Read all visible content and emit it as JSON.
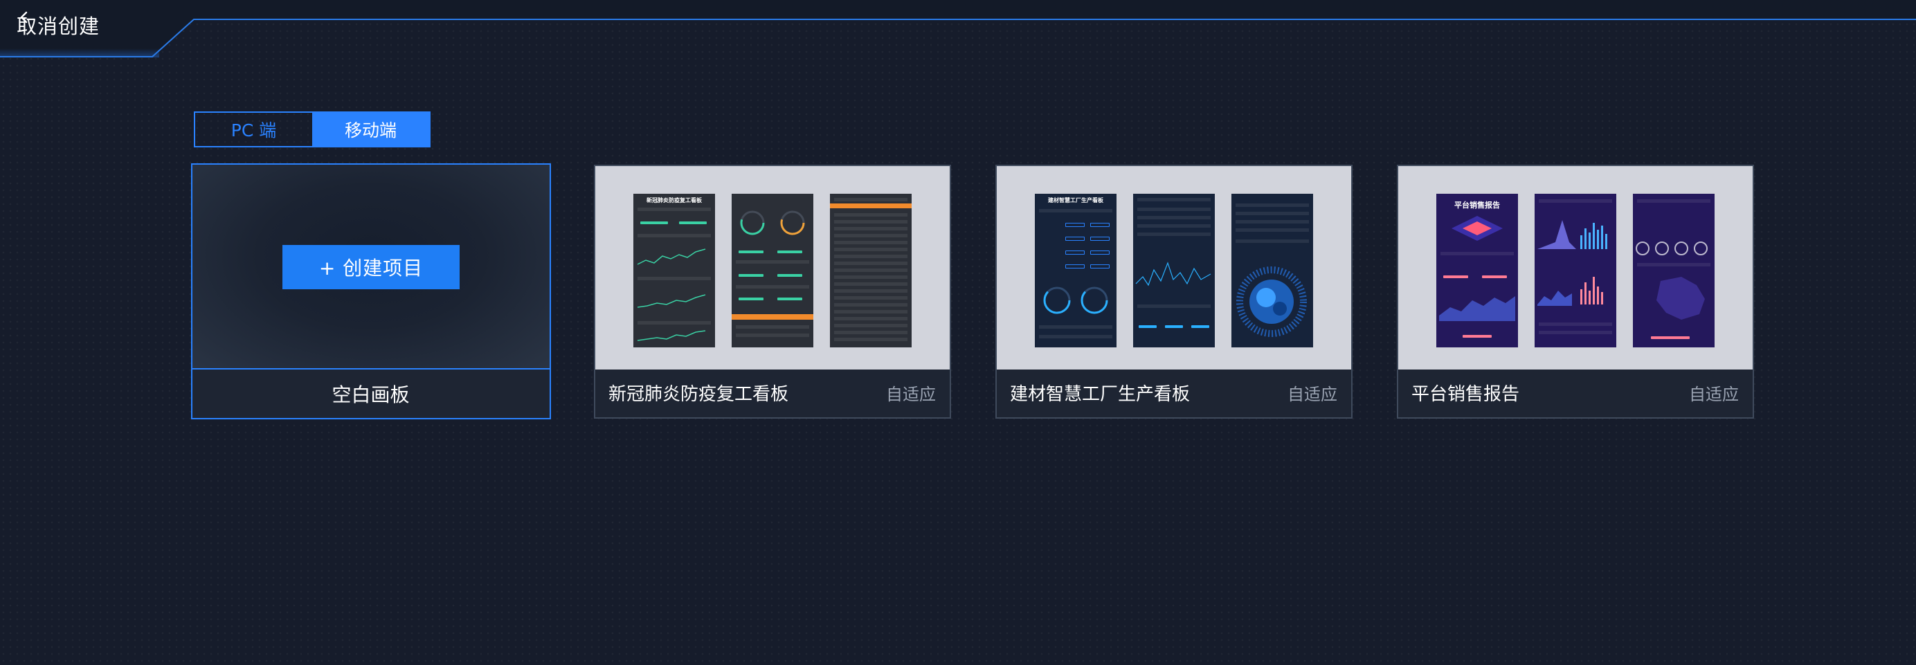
{
  "header": {
    "back_label": "取消创建",
    "back_icon": "chevron-left-icon"
  },
  "platform_switch": {
    "options": [
      "PC 端",
      "移动端"
    ],
    "selected": "移动端"
  },
  "cards": {
    "blank": {
      "name": "空白画板",
      "create_label": "+ 创建项目"
    },
    "templates": [
      {
        "name": "新冠肺炎防疫复工看板",
        "tag": "自适应",
        "preview_title": "新冠肺炎防疫复工看板"
      },
      {
        "name": "建材智慧工厂生产看板",
        "tag": "自适应",
        "preview_title": "建材智慧工厂生产看板"
      },
      {
        "name": "平台销售报告",
        "tag": "自适应",
        "preview_title": "平台销售报告"
      }
    ]
  },
  "colors": {
    "accent": "#2a82ff",
    "background": "#161c2b",
    "card_footer": "#1e2533",
    "muted_text": "#9aa3b2"
  }
}
